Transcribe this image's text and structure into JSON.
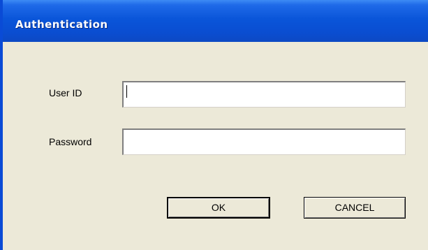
{
  "window": {
    "title": "Authentication"
  },
  "form": {
    "userid_label": "User ID",
    "userid_value": "",
    "password_label": "Password",
    "password_value": ""
  },
  "buttons": {
    "ok_label": "OK",
    "cancel_label": "CANCEL"
  },
  "colors": {
    "titlebar": "#0a55d9",
    "dialog_bg": "#ece9d8"
  }
}
